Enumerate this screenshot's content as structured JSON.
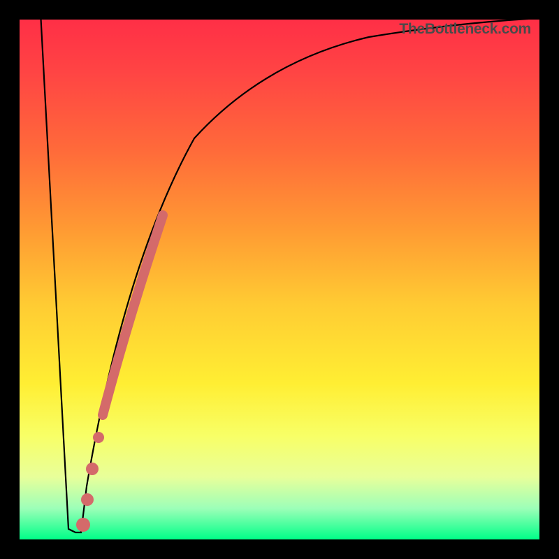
{
  "watermark": "TheBottleneck.com",
  "chart_data": {
    "type": "line",
    "title": "",
    "xlabel": "",
    "ylabel": "",
    "xlim": [
      0,
      100
    ],
    "ylim": [
      0,
      100
    ],
    "background_gradient": [
      "#ff2f46",
      "#ffcc33",
      "#00ff88"
    ],
    "series": [
      {
        "name": "bottleneck-curve",
        "type": "line",
        "x": [
          4,
          9,
          10,
          11,
          12,
          13,
          15,
          20,
          25,
          30,
          40,
          50,
          60,
          70,
          80,
          90,
          100
        ],
        "y": [
          100,
          2,
          1,
          1,
          1,
          8,
          22,
          45,
          60,
          70,
          82,
          88,
          91,
          93,
          94.5,
          95.5,
          96
        ]
      },
      {
        "name": "highlight-segment",
        "type": "scatter",
        "x": [
          15,
          16,
          17,
          18,
          19,
          20,
          21,
          22,
          23,
          24,
          25,
          26,
          27
        ],
        "y": [
          18,
          23,
          28,
          32,
          36,
          40,
          44,
          48,
          51,
          54,
          57,
          59,
          61
        ],
        "color": "#d46a6a"
      },
      {
        "name": "highlight-points-low",
        "type": "scatter",
        "x": [
          12,
          13,
          13.8,
          14.5
        ],
        "y": [
          3,
          8,
          13,
          15
        ],
        "color": "#d46a6a"
      }
    ]
  }
}
